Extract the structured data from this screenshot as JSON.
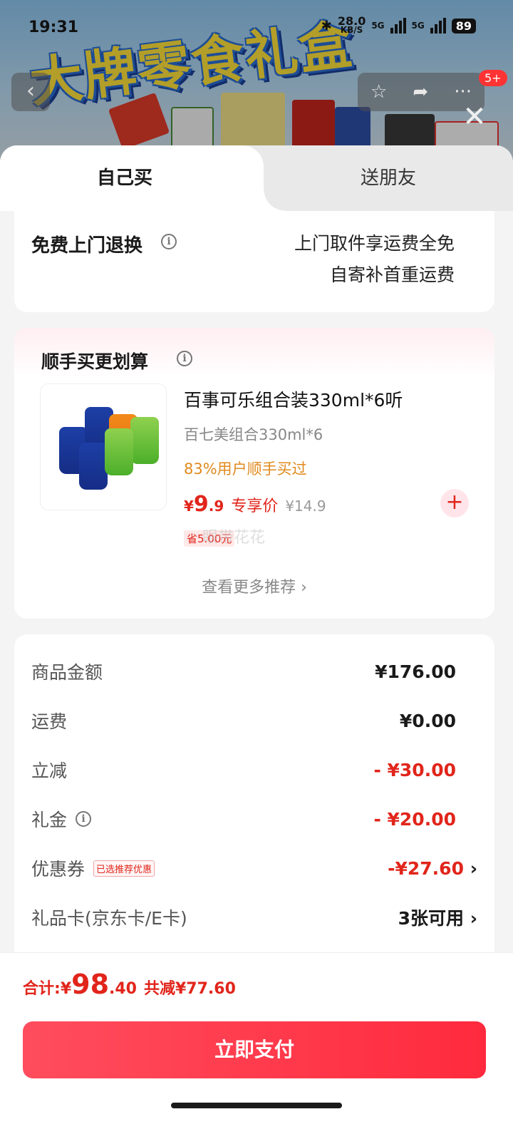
{
  "status_bar": {
    "time": "19:31",
    "net_speed": "28.0",
    "net_unit": "KB/S",
    "sig1": "5G",
    "sig2": "5G",
    "battery": "89"
  },
  "banner": {
    "title": "大牌零食礼盒"
  },
  "nav": {
    "back_icon": "chevron-left-icon",
    "badge": "5+"
  },
  "tabs": {
    "self": "自己买",
    "gift": "送朋友"
  },
  "return_service": {
    "title": "免费上门退换",
    "line1": "上门取件享运费全免",
    "line2": "自寄补首重运费"
  },
  "recommend": {
    "title": "顺手买更划算",
    "product": {
      "name": "百事可乐组合装330ml*6听",
      "sub": "百七美组合330ml*6",
      "stat": "83%用户顺手买过",
      "price_currency": "¥",
      "price_int": "9",
      "price_dec": ".9",
      "price_tag": "专享价",
      "orig_price": "¥14.9",
      "save": "省5.00元",
      "watermark": "眼带花花"
    },
    "more": "查看更多推荐 ›"
  },
  "cost": {
    "goods_label": "商品金额",
    "goods_value": "¥176.00",
    "ship_label": "运费",
    "ship_value": "¥0.00",
    "discount_label": "立减",
    "discount_value": "- ¥30.00",
    "gift_label": "礼金",
    "gift_value": "- ¥20.00",
    "coupon_label": "优惠券",
    "coupon_tag": "已选推荐优惠",
    "coupon_value": "-¥27.60",
    "card_label": "礼品卡(京东卡/E卡)",
    "card_value": "3张可用"
  },
  "footer": {
    "total_label": "合计: ",
    "total_currency": "¥",
    "total_int": "98",
    "total_dec": ".40",
    "saved": "共减¥77.60",
    "pay": "立即支付"
  },
  "colors": {
    "accent": "#e1251b",
    "pay_button": "#ff2a3d",
    "stat_orange": "#e08a1d"
  }
}
